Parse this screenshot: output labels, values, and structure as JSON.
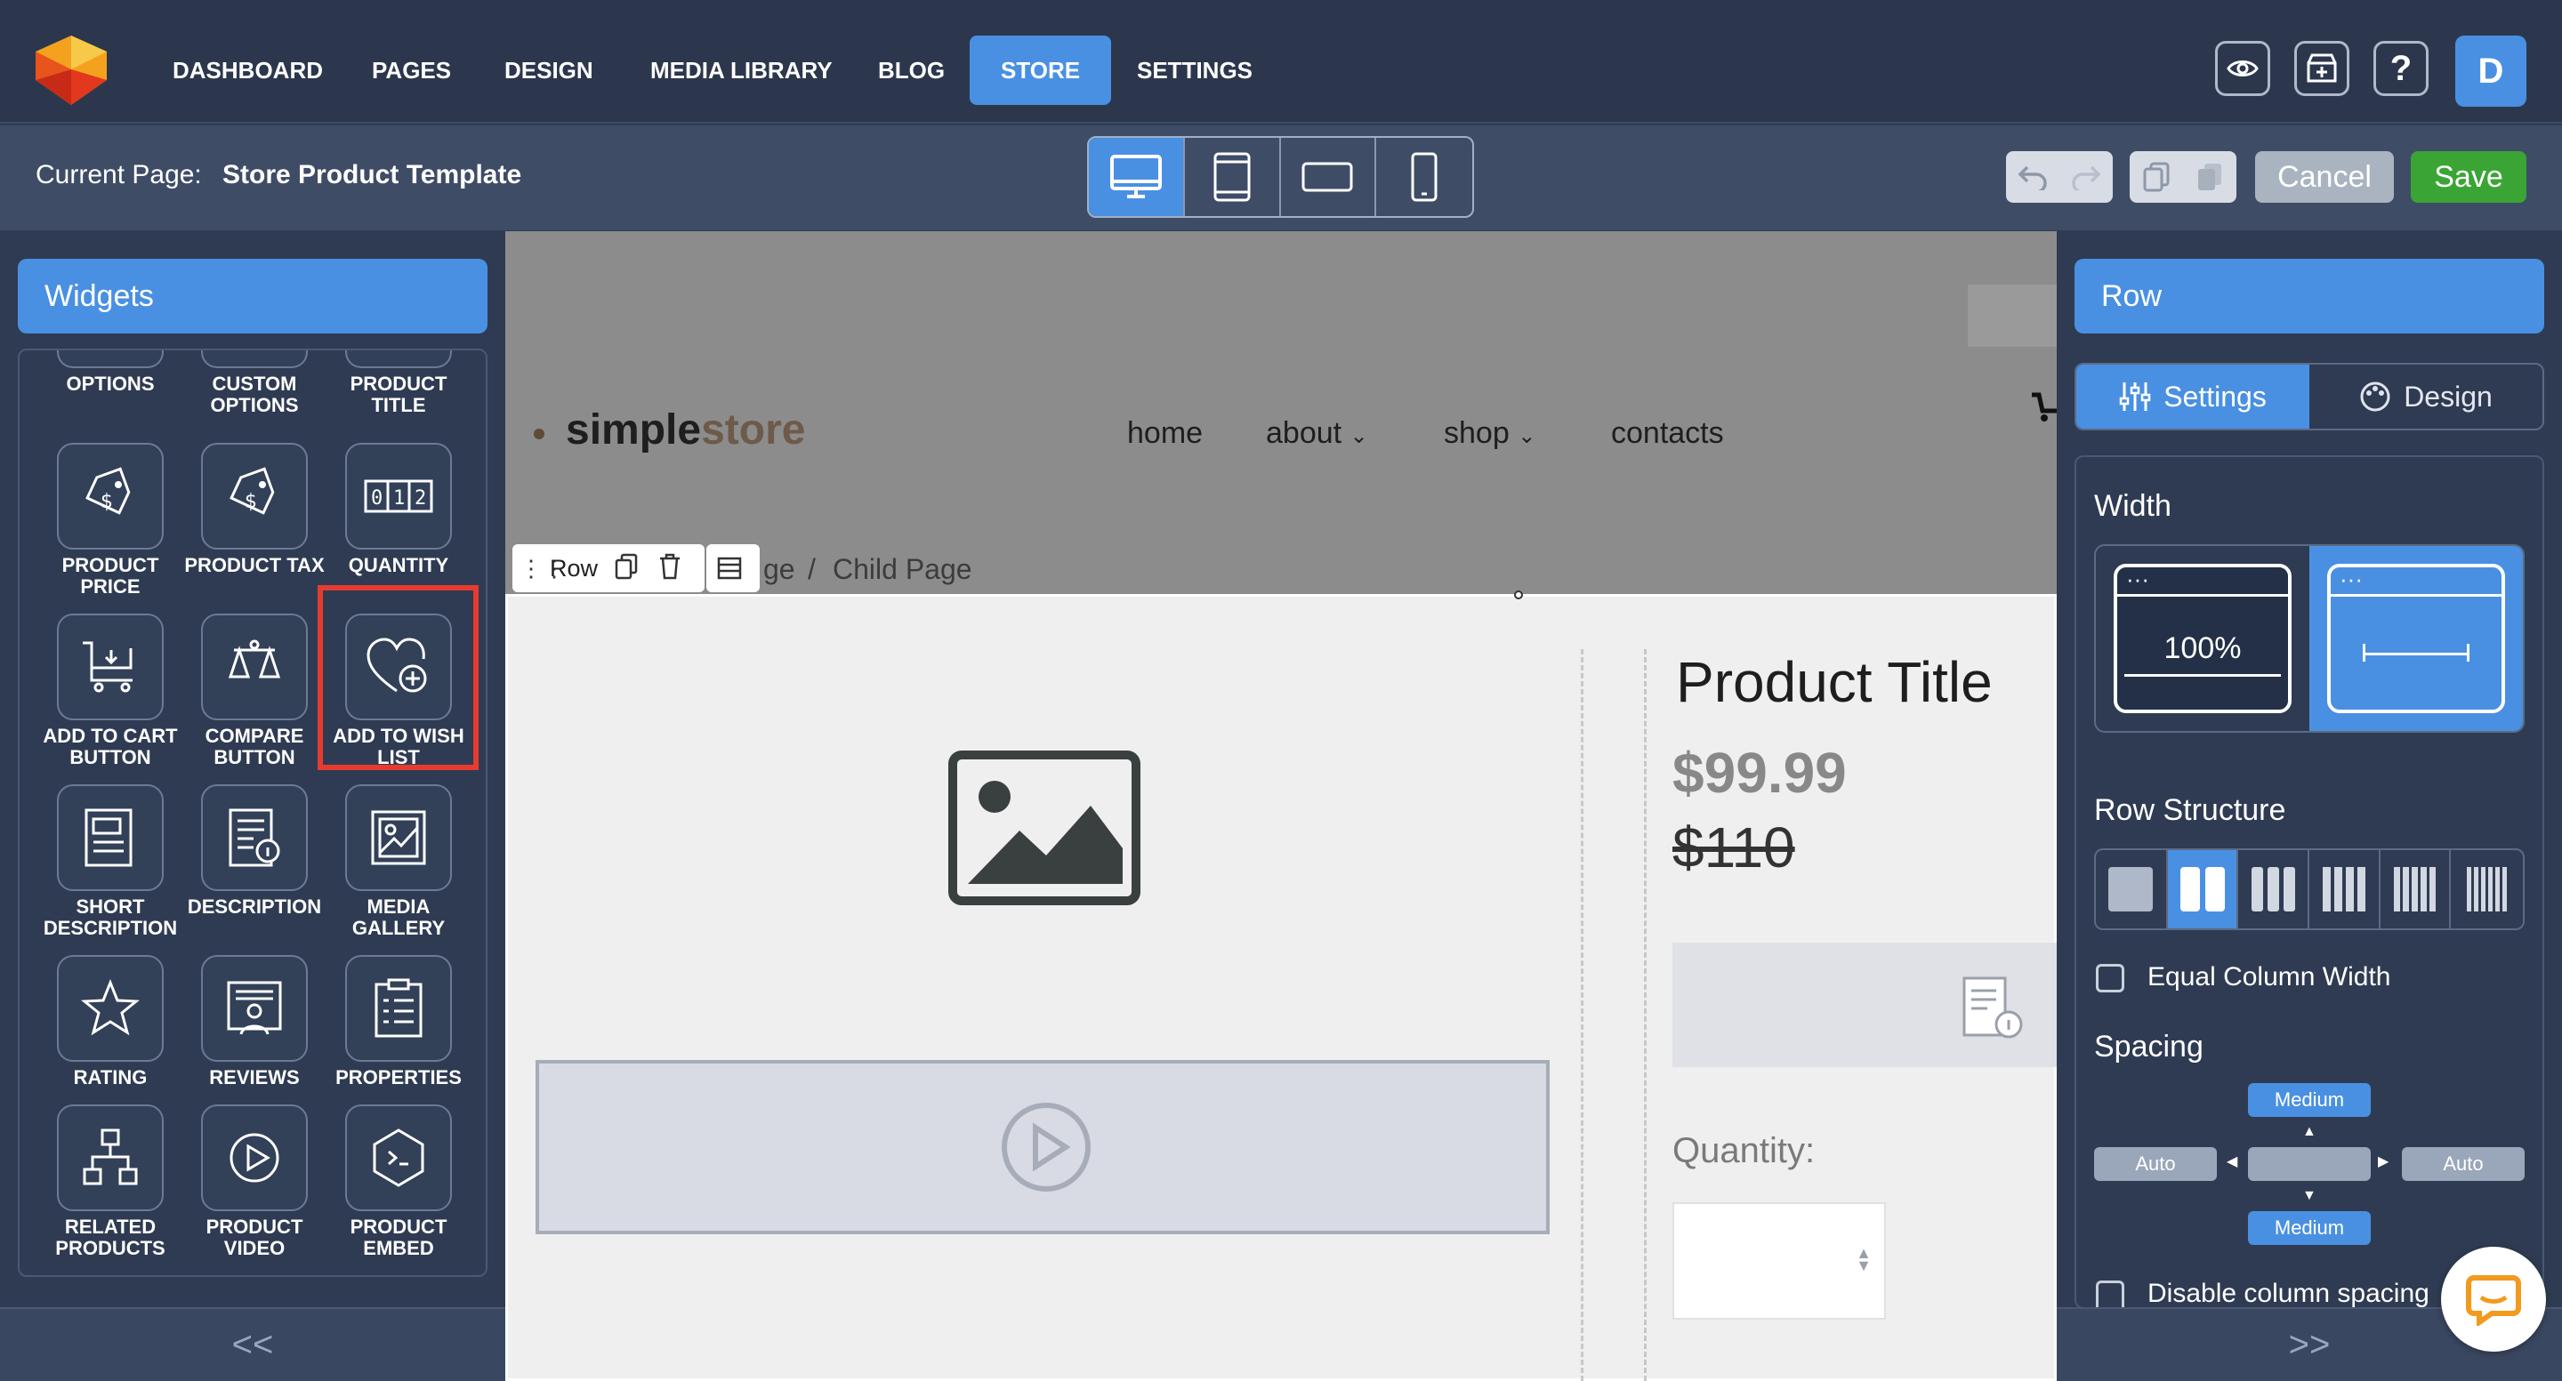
{
  "topbar": {
    "nav": [
      "DASHBOARD",
      "PAGES",
      "DESIGN",
      "MEDIA LIBRARY",
      "BLOG",
      "STORE",
      "SETTINGS"
    ],
    "active_nav": "STORE",
    "avatar_letter": "D",
    "icons": [
      "eye-icon",
      "store-add-icon",
      "help-icon"
    ]
  },
  "pagebar": {
    "current_label": "Current Page:",
    "current_value": "Store Product Template",
    "devices": [
      "desktop-icon",
      "tablet-icon",
      "tablet-landscape-icon",
      "mobile-icon"
    ],
    "cancel": "Cancel",
    "save": "Save"
  },
  "left": {
    "title": "Widgets",
    "top_row": [
      "OPTIONS",
      "CUSTOM OPTIONS",
      "PRODUCT TITLE"
    ],
    "items": [
      {
        "label": "PRODUCT PRICE",
        "icon": "price-tag-icon"
      },
      {
        "label": "PRODUCT TAX",
        "icon": "tax-tag-icon"
      },
      {
        "label": "QUANTITY",
        "icon": "quantity-icon"
      },
      {
        "label": "ADD TO CART BUTTON",
        "icon": "cart-icon"
      },
      {
        "label": "COMPARE BUTTON",
        "icon": "scales-icon"
      },
      {
        "label": "ADD TO WISH LIST",
        "icon": "heart-plus-icon"
      },
      {
        "label": "SHORT DESCRIPTION",
        "icon": "short-description-icon"
      },
      {
        "label": "DESCRIPTION",
        "icon": "description-icon"
      },
      {
        "label": "MEDIA GALLERY",
        "icon": "gallery-icon"
      },
      {
        "label": "RATING",
        "icon": "star-icon"
      },
      {
        "label": "REVIEWS",
        "icon": "reviews-icon"
      },
      {
        "label": "PROPERTIES",
        "icon": "properties-icon"
      },
      {
        "label": "RELATED PRODUCTS",
        "icon": "related-icon"
      },
      {
        "label": "PRODUCT VIDEO",
        "icon": "play-icon"
      },
      {
        "label": "PRODUCT EMBED",
        "icon": "embed-icon"
      }
    ],
    "collapse": "<<"
  },
  "canvas": {
    "brand_a": "simple",
    "brand_b": "store",
    "menu": [
      "home",
      "about",
      "shop",
      "contacts"
    ],
    "row_label": "Row",
    "breadcrumb_partial": "ge",
    "breadcrumb_sep": "/",
    "breadcrumb_child": "Child Page",
    "product_title": "Product Title",
    "price": "$99.99",
    "old_price": "$110",
    "quantity_label": "Quantity:"
  },
  "right": {
    "title": "Row",
    "tab_settings": "Settings",
    "tab_design": "Design",
    "width_label": "Width",
    "width_full": "100%",
    "row_structure": "Row Structure",
    "equal_columns": "Equal Column Width",
    "spacing": "Spacing",
    "spacing_top": "Medium",
    "spacing_bottom": "Medium",
    "spacing_left": "Auto",
    "spacing_right": "Auto",
    "disable_spacing": "Disable column spacing",
    "expand": ">>"
  },
  "colors": {
    "accent": "#4a90e2",
    "save": "#3aa534",
    "highlight": "#e63c2f",
    "bg": "#2f3b52"
  }
}
